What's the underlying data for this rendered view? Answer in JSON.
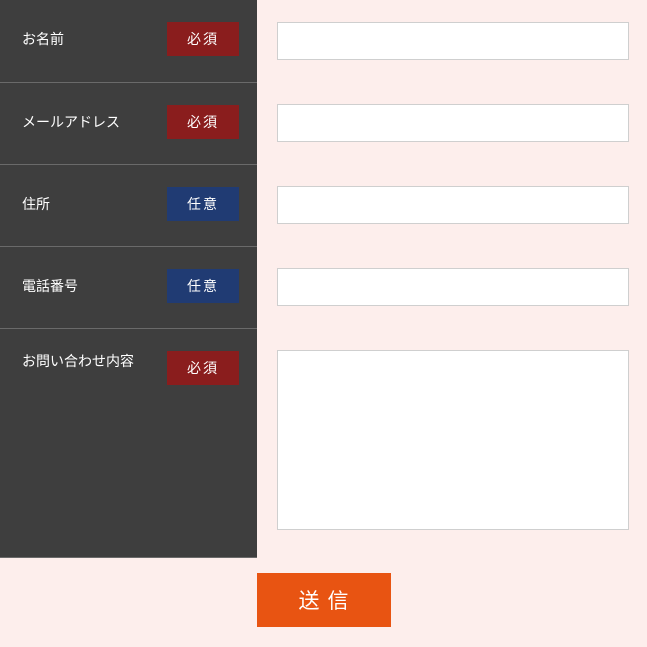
{
  "form": {
    "fields": [
      {
        "label": "お名前",
        "badge": "必須",
        "badge_type": "required",
        "input": "text"
      },
      {
        "label": "メールアドレス",
        "badge": "必須",
        "badge_type": "required",
        "input": "text"
      },
      {
        "label": "住所",
        "badge": "任意",
        "badge_type": "optional",
        "input": "text"
      },
      {
        "label": "電話番号",
        "badge": "任意",
        "badge_type": "optional",
        "input": "text"
      },
      {
        "label": "お問い合わせ内容",
        "badge": "必須",
        "badge_type": "required",
        "input": "textarea"
      }
    ],
    "submit_label": "送信"
  },
  "colors": {
    "label_bg": "#3e3e3e",
    "input_bg": "#fdeeec",
    "required": "#8a1d1d",
    "optional": "#203b73",
    "submit": "#e85412"
  }
}
